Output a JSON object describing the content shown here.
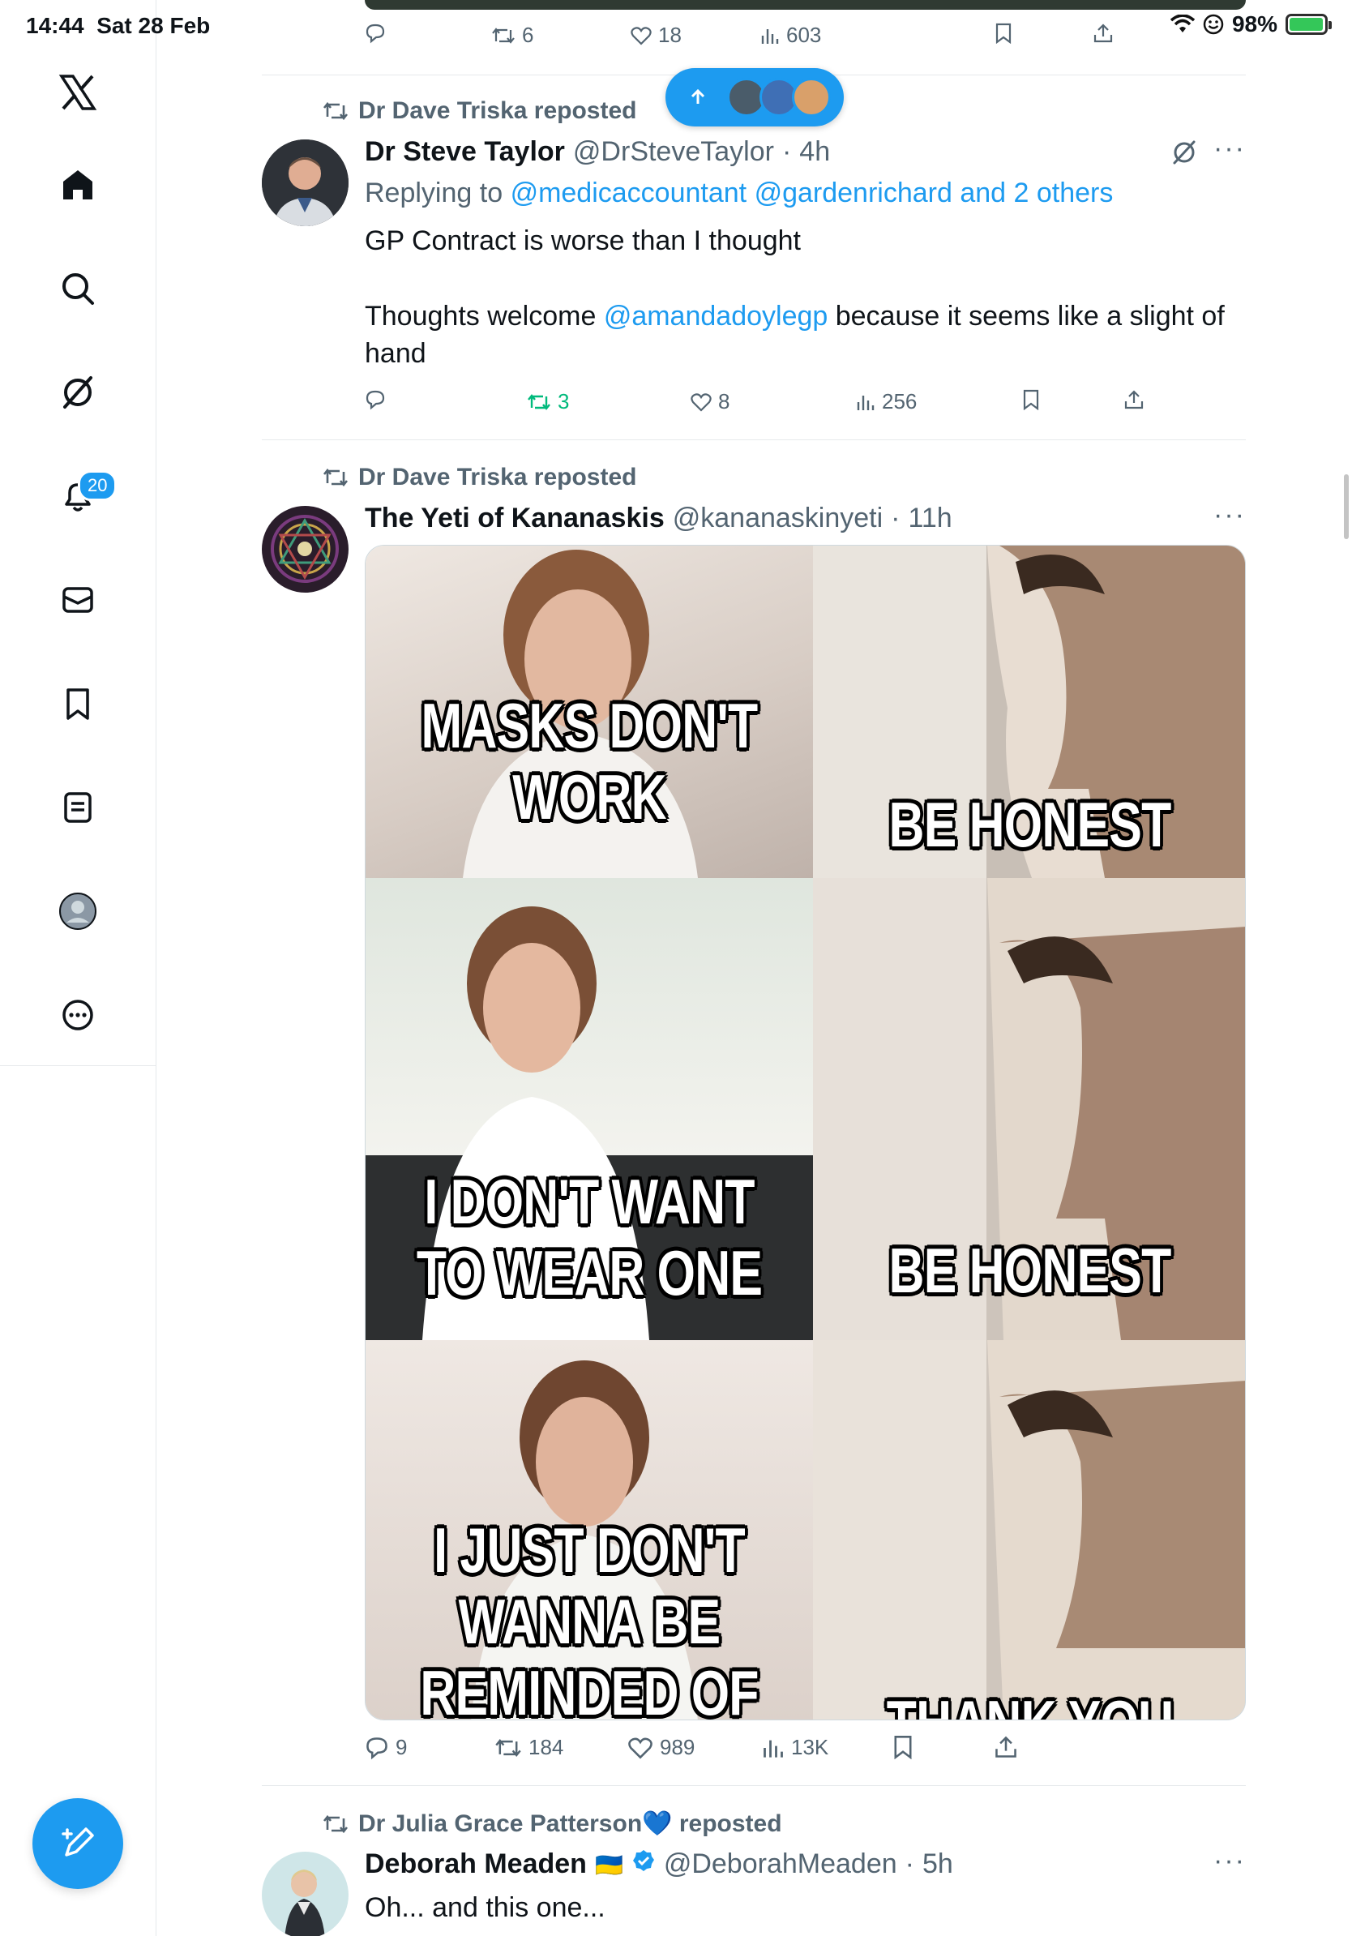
{
  "status": {
    "time": "14:44",
    "date": "Sat 28 Feb",
    "battery": "98%",
    "battery_level": 0.98
  },
  "sidebar": {
    "notifications_count": "20"
  },
  "top_tweet_stats": {
    "retweets": "6",
    "likes": "18",
    "views": "603"
  },
  "tweets": [
    {
      "reposted_by": "Dr Dave Triska reposted",
      "name": "Dr Steve Taylor",
      "handle": "@DrSteveTaylor",
      "time": "4h",
      "replying_prefix": "Replying to",
      "replying_to": "@medicaccountant @gardenrichard and 2 others",
      "text_line1": "GP Contract is worse than I thought",
      "text_p2_a": "Thoughts welcome ",
      "text_p2_mention": "@amandadoylegp",
      "text_p2_b": " because it seems like a slight of hand",
      "stats": {
        "replies": "",
        "retweets": "3",
        "likes": "8",
        "views": "256"
      }
    },
    {
      "reposted_by": "Dr Dave Triska reposted",
      "name": "The Yeti of Kananaskis",
      "handle": "@kananaskinyeti",
      "time": "11h",
      "meme": {
        "left_1": "MASKS DON'T WORK",
        "right_1": "BE HONEST",
        "left_2": "I DON'T WANT TO WEAR ONE",
        "right_2": "BE HONEST",
        "left_3": "I JUST DON'T WANNA BE REMINDED OF THE",
        "right_3": "THANK YOU"
      },
      "stats": {
        "replies": "9",
        "retweets": "184",
        "likes": "989",
        "views": "13K"
      }
    },
    {
      "reposted_by": "Dr Julia Grace Patterson💙 reposted",
      "name": "Deborah Meaden",
      "flag": "🇺🇦",
      "handle": "@DeborahMeaden",
      "time": "5h",
      "text_line1": "Oh... and this one..."
    }
  ],
  "colors": {
    "accent": "#1d9bf0",
    "retweet_active": "#00ba7c",
    "muted": "#536471"
  }
}
